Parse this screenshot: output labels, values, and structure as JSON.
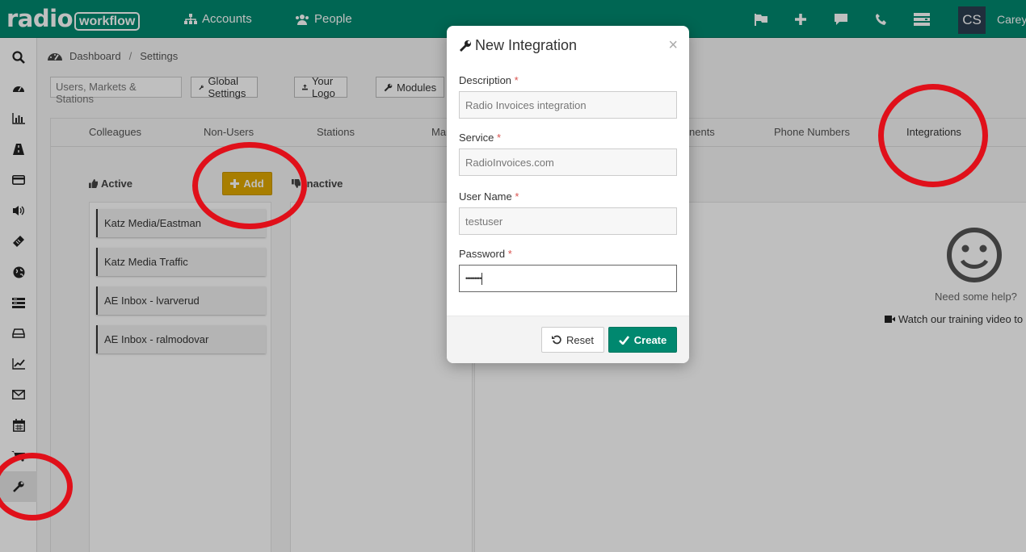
{
  "topbar": {
    "logo_main": "radio",
    "logo_sub": "workflow",
    "nav": [
      {
        "label": "Accounts",
        "icon": "sitemap-icon"
      },
      {
        "label": "People",
        "icon": "users-icon"
      }
    ],
    "icons": [
      "flag-icon",
      "plus-icon",
      "chat-icon",
      "phone-icon",
      "server-icon"
    ],
    "avatar_initials": "CS",
    "user_name": "Carey"
  },
  "sidebar": {
    "items": [
      "search-icon",
      "dashboard-icon",
      "bar-chart-icon",
      "road-icon",
      "credit-card-icon",
      "volume-icon",
      "ticket-icon",
      "globe-icon",
      "list-icon",
      "drive-icon",
      "line-chart-icon",
      "envelope-icon",
      "calendar-icon",
      "cart-icon",
      "wrench-icon"
    ],
    "active": "wrench-icon"
  },
  "breadcrumb": {
    "home": "Dashboard",
    "separator": "/",
    "current": "Settings"
  },
  "toolbar": {
    "search_value": "Users, Markets & Stations",
    "global_settings": "Global Settings",
    "your_logo": "Your Logo",
    "modules": "Modules"
  },
  "tabs": {
    "colleagues": "Colleagues",
    "non_users": "Non-Users",
    "stations": "Stations",
    "markets_partial": "Mar",
    "documents_partial": "nents",
    "phone_numbers": "Phone Numbers",
    "integrations": "Integrations"
  },
  "columns": {
    "active_label": "Active",
    "add_label": "Add",
    "inactive_label": "Inactive"
  },
  "integrations": [
    "Katz Media/Eastman",
    "Katz Media Traffic",
    "AE Inbox - lvarverud",
    "AE Inbox - ralmodovar"
  ],
  "help": {
    "question": "Need some help?",
    "video_link": "Watch our training video to ge"
  },
  "modal": {
    "title": "New Integration",
    "close": "×",
    "required_marker": "*",
    "description_label": "Description",
    "description_placeholder": "Radio Invoices integration",
    "service_label": "Service",
    "service_placeholder": "RadioInvoices.com",
    "username_label": "User Name",
    "username_placeholder": "testuser",
    "password_label": "Password",
    "password_value": "•••••••••",
    "reset_label": "Reset",
    "create_label": "Create"
  },
  "colors": {
    "brand": "#00886f",
    "add_button": "#e0a800",
    "annotation": "#e0101a",
    "avatar_bg": "#2b3e50"
  }
}
